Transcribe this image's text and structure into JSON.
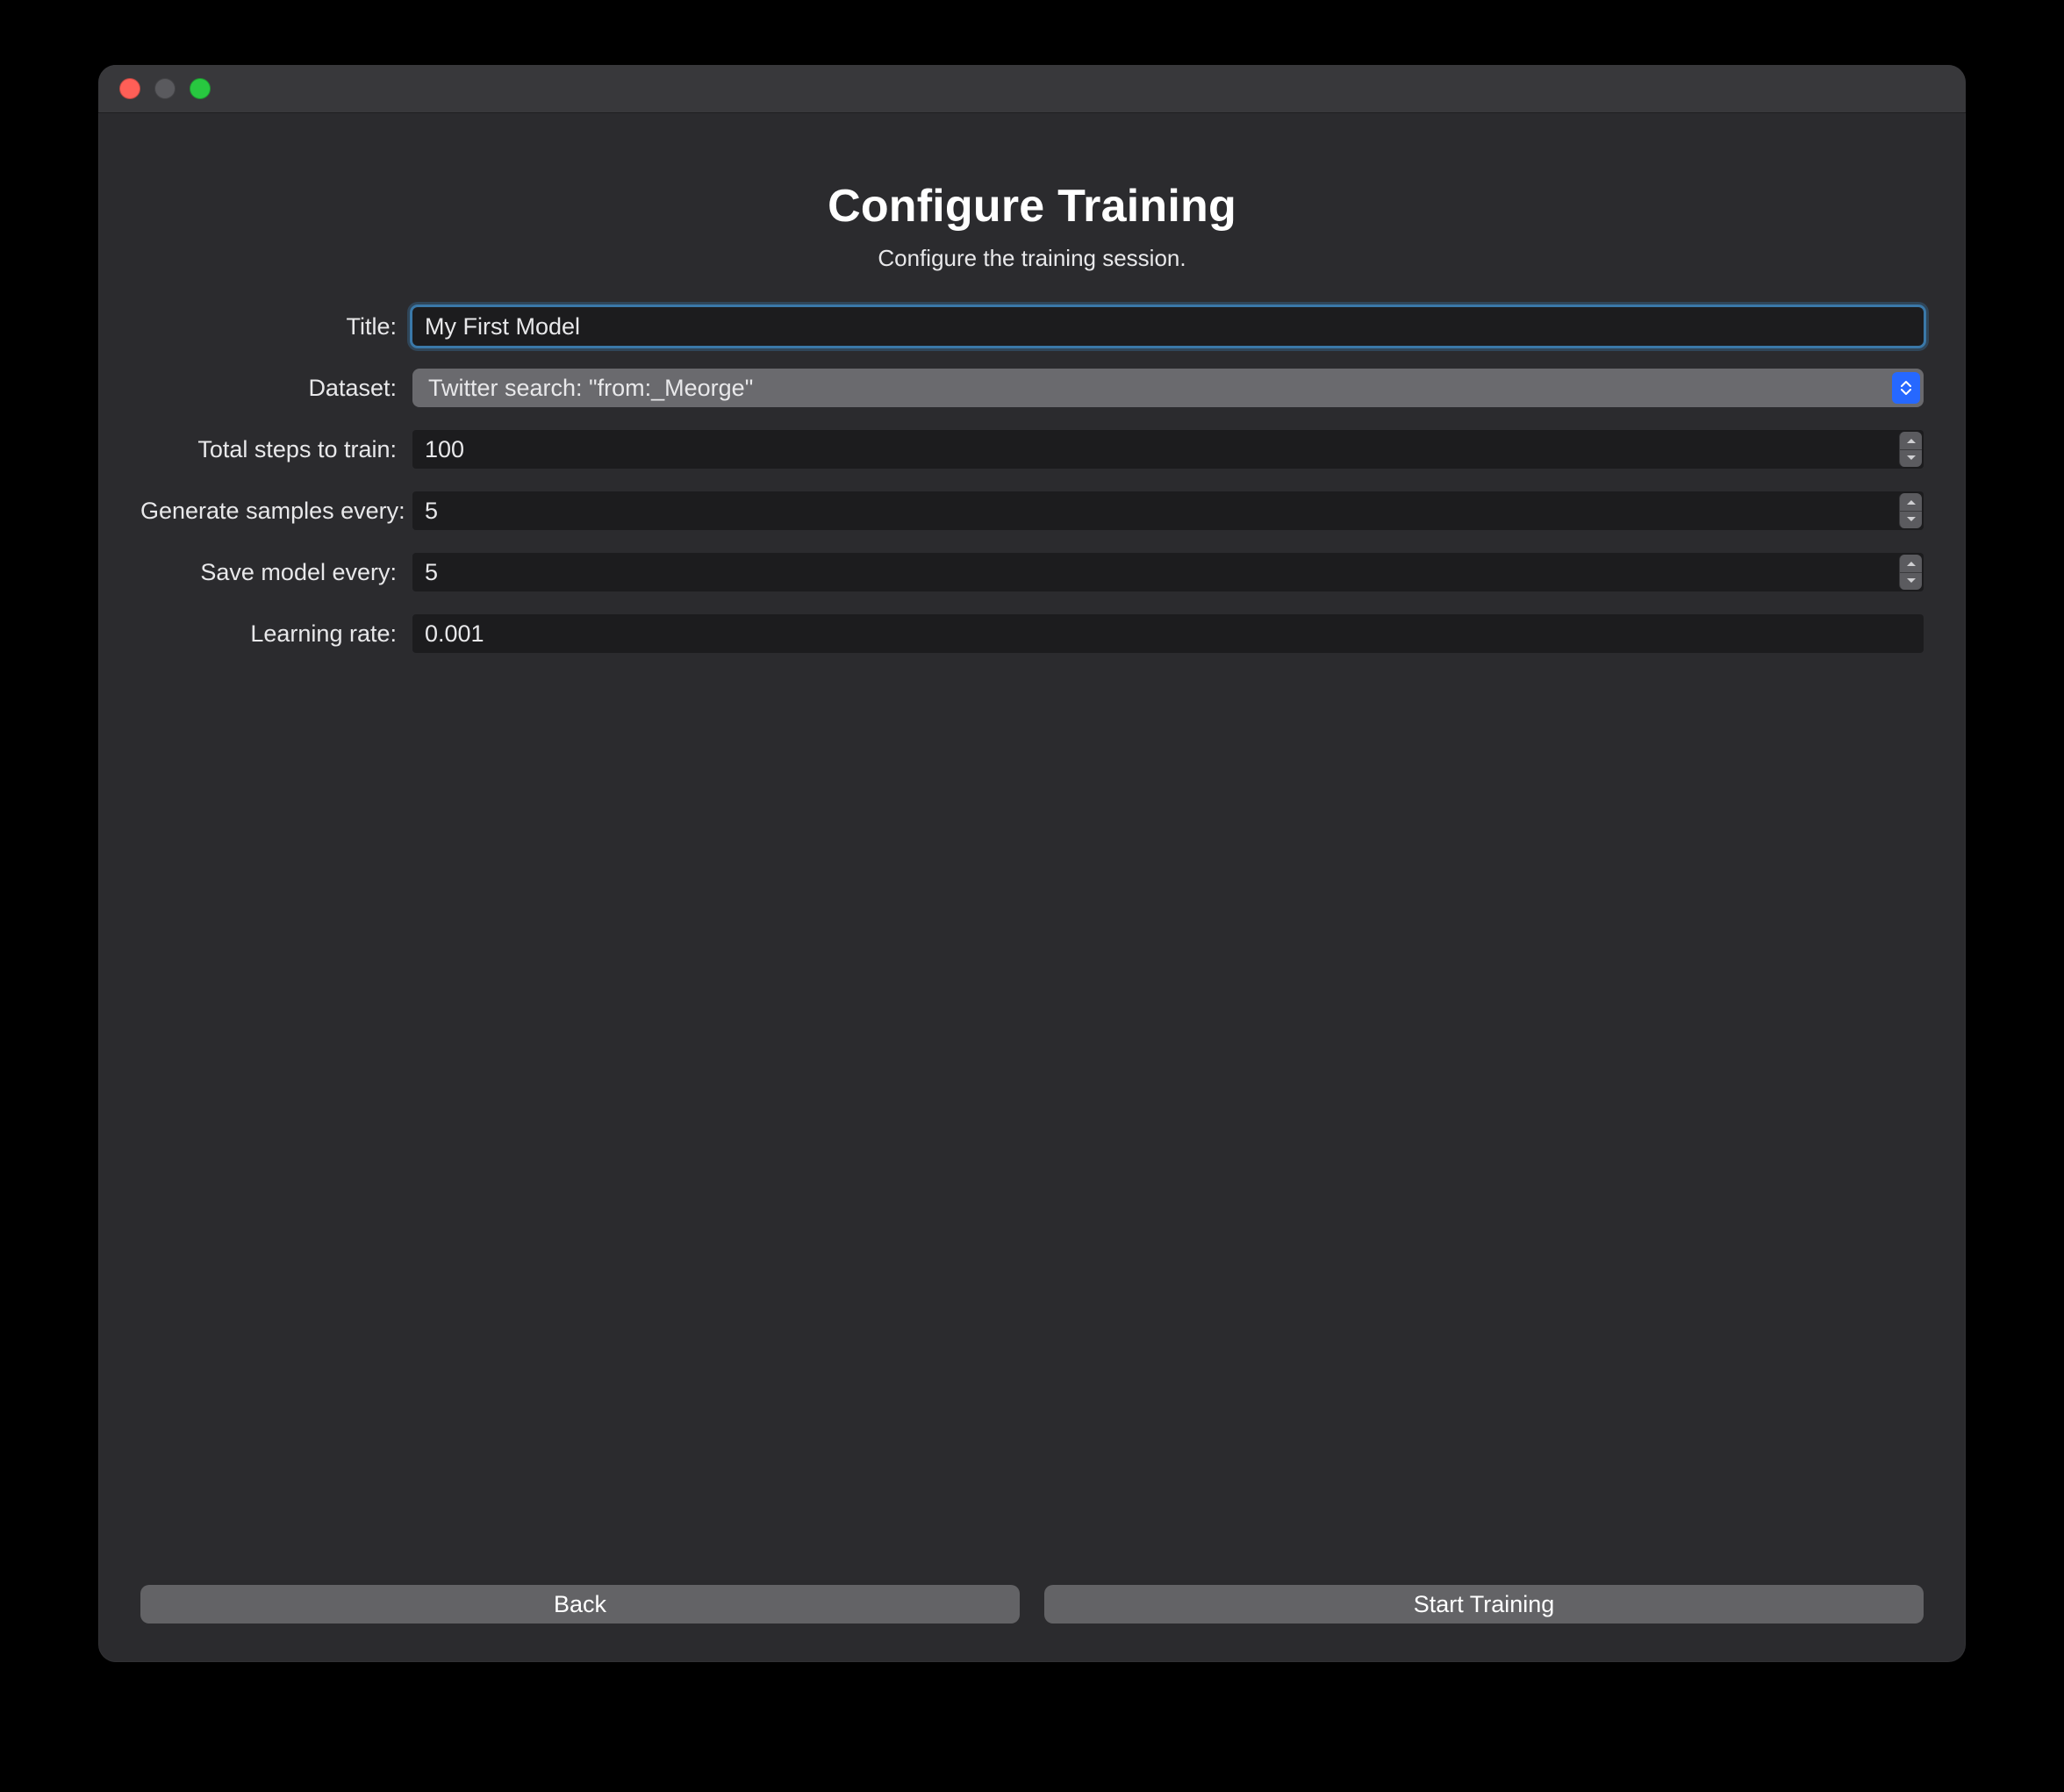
{
  "header": {
    "title": "Configure Training",
    "subtitle": "Configure the training session."
  },
  "form": {
    "title": {
      "label": "Title:",
      "value": "My First Model"
    },
    "dataset": {
      "label": "Dataset:",
      "value": "Twitter search: \"from:_Meorge\""
    },
    "steps": {
      "label": "Total steps to train:",
      "value": "100"
    },
    "gen": {
      "label": "Generate samples every:",
      "value": "5"
    },
    "save": {
      "label": "Save model every:",
      "value": "5"
    },
    "lr": {
      "label": "Learning rate:",
      "value": "0.001"
    }
  },
  "footer": {
    "back": "Back",
    "start": "Start Training"
  }
}
